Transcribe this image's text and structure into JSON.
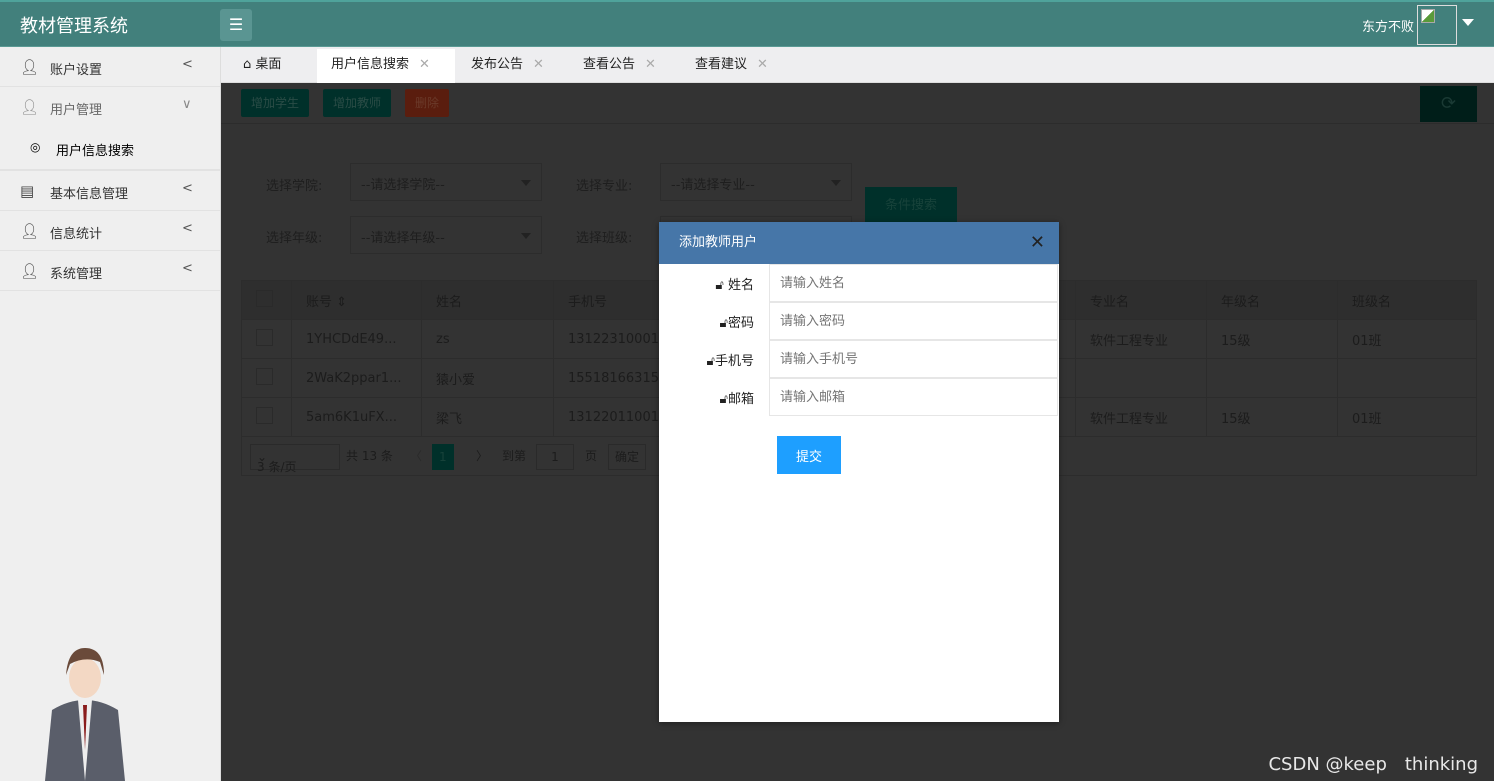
{
  "header": {
    "title": "教材管理系统",
    "menu_icon": "list-icon",
    "username": "东方不败"
  },
  "sidebar": {
    "items": [
      {
        "label": "账户设置",
        "icon": "user-icon",
        "arrow": "<"
      },
      {
        "label": "用户管理",
        "icon": "user-icon",
        "arrow": "∨",
        "children": [
          {
            "label": "用户信息搜索",
            "icon": "user-circle-icon"
          }
        ]
      },
      {
        "label": "基本信息管理",
        "icon": "table-icon",
        "arrow": "<"
      },
      {
        "label": "信息统计",
        "icon": "user-icon",
        "arrow": "<"
      },
      {
        "label": "系统管理",
        "icon": "user-icon",
        "arrow": "<"
      }
    ]
  },
  "tabs": [
    {
      "label": "桌面",
      "icon": "home-icon"
    },
    {
      "label": "用户信息搜索",
      "active": true
    },
    {
      "label": "发布公告"
    },
    {
      "label": "查看公告"
    },
    {
      "label": "查看建议"
    }
  ],
  "toolbar": {
    "add_student": "增加学生",
    "add_teacher": "增加教师",
    "delete": "删除",
    "refresh_icon": "refresh-icon"
  },
  "filters": {
    "college_label": "选择学院:",
    "college_value": "--请选择学院--",
    "major_label": "选择专业:",
    "major_value": "--请选择专业--",
    "grade_label": "选择年级:",
    "grade_value": "--请选择年级--",
    "class_label": "选择班级:",
    "search_button": "条件搜索"
  },
  "table": {
    "headers": [
      "账号",
      "姓名",
      "手机号",
      "专业名",
      "年级名",
      "班级名"
    ],
    "rows": [
      [
        "1YHCDdE49...",
        "zs",
        "13122310001",
        "软件工程专业",
        "15级",
        "01班"
      ],
      [
        "2WaK2ppar1...",
        "猿小爱",
        "15518166315",
        "",
        "",
        ""
      ],
      [
        "5am6K1uFX...",
        "梁飞",
        "13122011001",
        "软件工程专业",
        "15级",
        "01班"
      ]
    ]
  },
  "pager": {
    "page_size": "3 条/页",
    "total": "共 13 条",
    "current": "1",
    "goto": "到第",
    "goto_value": "1",
    "page_unit": "页",
    "confirm": "确定"
  },
  "modal": {
    "title": "添加教师用户",
    "fields": [
      {
        "label": "姓名",
        "placeholder": "请输入姓名"
      },
      {
        "label": "密码",
        "placeholder": "请输入密码"
      },
      {
        "label": "手机号",
        "placeholder": "请输入手机号"
      },
      {
        "label": "邮箱",
        "placeholder": "请输入邮箱"
      }
    ],
    "submit": "提交"
  },
  "watermark": "CSDN @keep　thinking",
  "colors": {
    "header": "#42807c",
    "modal_header": "#4676a8",
    "submit": "#1e9fff"
  }
}
